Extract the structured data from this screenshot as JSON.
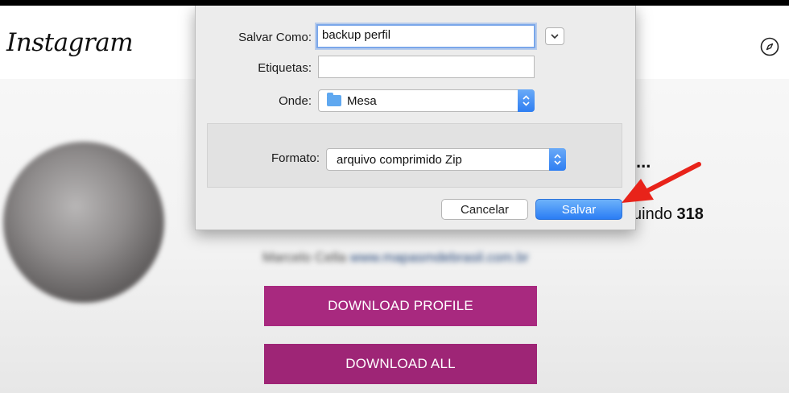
{
  "app": {
    "logo_text": "Instagram",
    "nav_icon": "compass-icon"
  },
  "profile": {
    "username_tail": "...",
    "following_label": "uindo",
    "following_count": "318",
    "bio_name": "Marcelo Cella",
    "bio_link": "www.mapasmdebrasil.com.br",
    "download_profile_label": "DOWNLOAD PROFILE",
    "download_all_label": "DOWNLOAD ALL",
    "button_color": "#a8297f"
  },
  "save_dialog": {
    "save_as_label": "Salvar Como:",
    "save_as_value": "backup perfil",
    "tags_label": "Etiquetas:",
    "tags_value": "",
    "where_label": "Onde:",
    "where_value": "Mesa",
    "where_icon": "folder-icon",
    "format_label": "Formato:",
    "format_value": "arquivo comprimido Zip",
    "cancel_label": "Cancelar",
    "save_label": "Salvar",
    "accent_color": "#2b7df4"
  },
  "annotation": {
    "arrow_color": "#e8231a"
  }
}
